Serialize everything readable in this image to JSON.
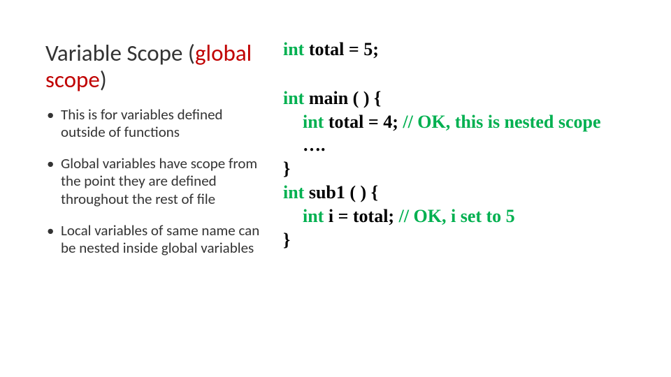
{
  "title": {
    "prefix": "Variable Scope (",
    "accent": "global scope",
    "suffix": ")"
  },
  "bullets": {
    "b1": "This is for variables defined outside of functions",
    "b2": "Global variables have scope from the point they are defined throughout the rest of file",
    "b3": "Local variables of same name can be nested inside global variables"
  },
  "code": {
    "l1": {
      "kw": "int",
      "rest": " total = 5;"
    },
    "l3": {
      "kw": "int",
      "rest": " main ( ) {"
    },
    "l4": {
      "kw": "int",
      "mid": " total = 4; ",
      "cm": "// OK, this is nested scope"
    },
    "l5": {
      "dots": "…."
    },
    "l6": {
      "brace": "}"
    },
    "l7": {
      "kw": "int",
      "rest": " sub1 ( ) {"
    },
    "l8": {
      "kw": "int",
      "mid": " i = total;  ",
      "cm": "// OK, i set to 5"
    },
    "l9": {
      "brace": "}"
    }
  }
}
